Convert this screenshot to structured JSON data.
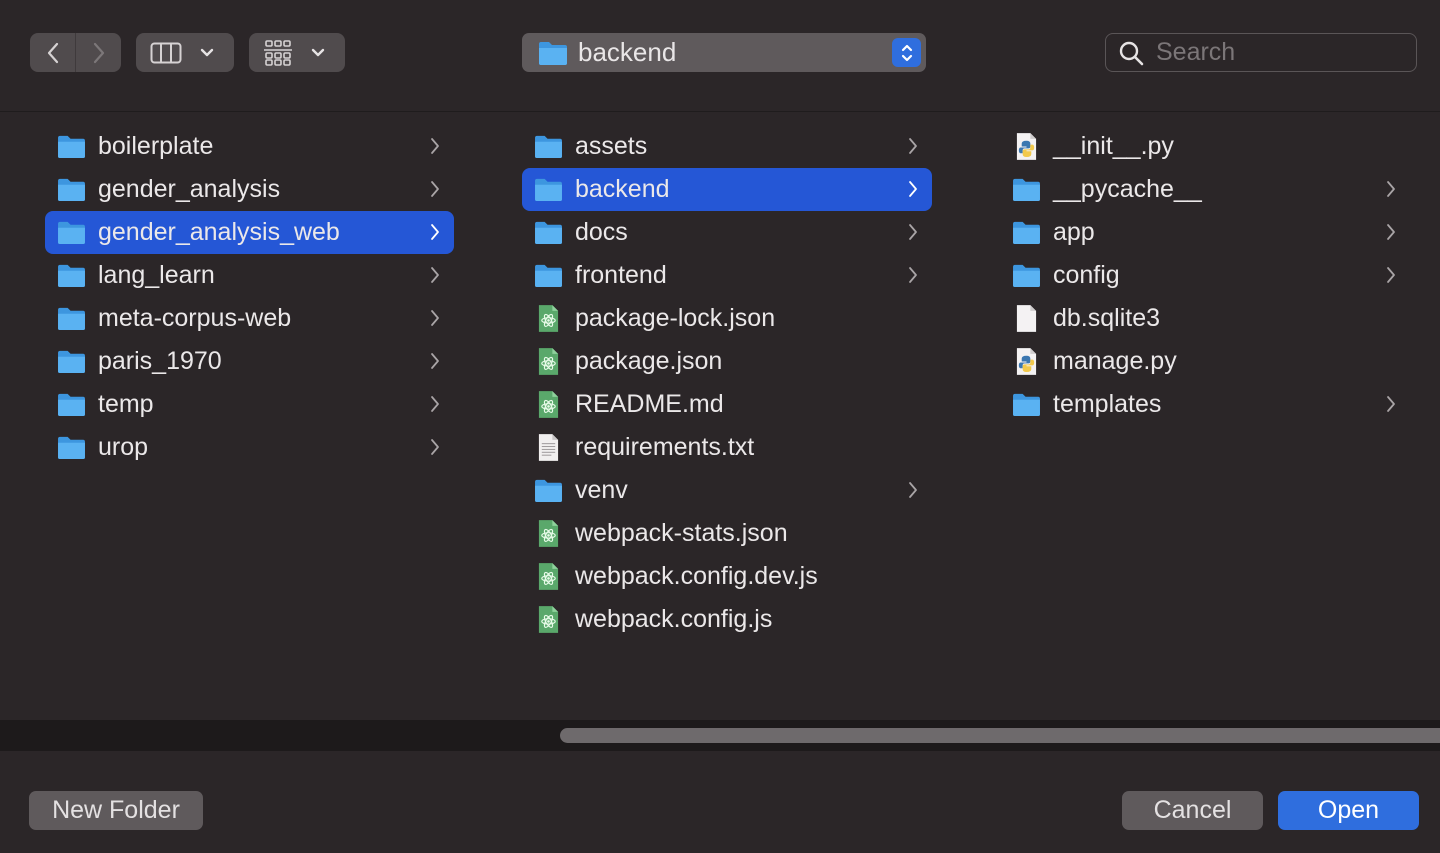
{
  "toolbar": {
    "back_icon": "chevron-left-icon",
    "forward_icon": "chevron-right-icon",
    "view_mode_icon": "columns-view-icon",
    "group_icon": "grid-group-icon",
    "path_label": "backend",
    "search_placeholder": "Search"
  },
  "columns": [
    {
      "items": [
        {
          "name": "boilerplate",
          "kind": "folder",
          "has_children": true,
          "selected": false
        },
        {
          "name": "gender_analysis",
          "kind": "folder",
          "has_children": true,
          "selected": false
        },
        {
          "name": "gender_analysis_web",
          "kind": "folder",
          "has_children": true,
          "selected": true
        },
        {
          "name": "lang_learn",
          "kind": "folder",
          "has_children": true,
          "selected": false
        },
        {
          "name": "meta-corpus-web",
          "kind": "folder",
          "has_children": true,
          "selected": false
        },
        {
          "name": "paris_1970",
          "kind": "folder",
          "has_children": true,
          "selected": false
        },
        {
          "name": "temp",
          "kind": "folder",
          "has_children": true,
          "selected": false
        },
        {
          "name": "urop",
          "kind": "folder",
          "has_children": true,
          "selected": false
        }
      ]
    },
    {
      "items": [
        {
          "name": "assets",
          "kind": "folder",
          "has_children": true,
          "selected": false
        },
        {
          "name": "backend",
          "kind": "folder",
          "has_children": true,
          "selected": true
        },
        {
          "name": "docs",
          "kind": "folder",
          "has_children": true,
          "selected": false
        },
        {
          "name": "frontend",
          "kind": "folder",
          "has_children": true,
          "selected": false
        },
        {
          "name": "package-lock.json",
          "kind": "atom-file",
          "has_children": false,
          "selected": false
        },
        {
          "name": "package.json",
          "kind": "atom-file",
          "has_children": false,
          "selected": false
        },
        {
          "name": "README.md",
          "kind": "atom-file",
          "has_children": false,
          "selected": false
        },
        {
          "name": "requirements.txt",
          "kind": "text-file",
          "has_children": false,
          "selected": false
        },
        {
          "name": "venv",
          "kind": "folder",
          "has_children": true,
          "selected": false
        },
        {
          "name": "webpack-stats.json",
          "kind": "atom-file",
          "has_children": false,
          "selected": false
        },
        {
          "name": "webpack.config.dev.js",
          "kind": "atom-file",
          "has_children": false,
          "selected": false
        },
        {
          "name": "webpack.config.js",
          "kind": "atom-file",
          "has_children": false,
          "selected": false
        }
      ]
    },
    {
      "items": [
        {
          "name": "__init__.py",
          "kind": "python-file",
          "has_children": false,
          "selected": false
        },
        {
          "name": "__pycache__",
          "kind": "folder",
          "has_children": true,
          "selected": false
        },
        {
          "name": "app",
          "kind": "folder",
          "has_children": true,
          "selected": false
        },
        {
          "name": "config",
          "kind": "folder",
          "has_children": true,
          "selected": false
        },
        {
          "name": "db.sqlite3",
          "kind": "blank-file",
          "has_children": false,
          "selected": false
        },
        {
          "name": "manage.py",
          "kind": "python-file",
          "has_children": false,
          "selected": false
        },
        {
          "name": "templates",
          "kind": "folder",
          "has_children": true,
          "selected": false
        }
      ]
    }
  ],
  "footer": {
    "new_folder_label": "New Folder",
    "cancel_label": "Cancel",
    "open_label": "Open"
  },
  "colors": {
    "accent": "#2f6ede",
    "selection": "#2557d6",
    "folder": "#4aa6ec",
    "background": "#2b2628"
  }
}
